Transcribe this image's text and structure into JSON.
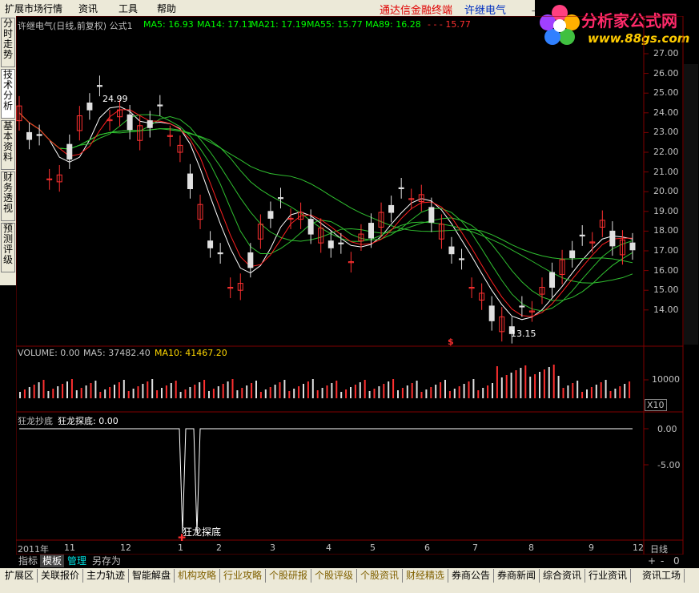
{
  "menubar": {
    "items": [
      "扩展市场行情",
      "资讯",
      "工具",
      "帮助"
    ],
    "brand_title": "通达信金融终端",
    "brand_stock": "许继电气",
    "window_buttons": [
      "_",
      "□",
      "×"
    ]
  },
  "logo": {
    "text": "分析家公式网",
    "url": "www.88gs.com"
  },
  "left_tabs": [
    "分时走势",
    "技术分析",
    "基本资料",
    "财务透视",
    "预测评级"
  ],
  "price_panel": {
    "title": "许继电气(日线,前复权) 公式1",
    "ma_labels": [
      "MA5: 16.93",
      "MA14: 17.11",
      "MA21: 17.19",
      "MA55: 15.77",
      "MA89: 16.28"
    ],
    "extra_marks": "- - -  15.77",
    "y_ticks": [
      "27.00",
      "26.00",
      "25.00",
      "24.00",
      "23.00",
      "22.00",
      "21.00",
      "20.00",
      "19.00",
      "18.00",
      "17.00",
      "16.00",
      "15.00",
      "14.00"
    ],
    "high_label": "24.99",
    "low_label": "13.15",
    "dollar_mark": "$"
  },
  "volume_panel": {
    "label": "VOLUME: 0.00",
    "ma5": "MA5: 37482.40",
    "ma10": "MA10: 41467.20",
    "y_tick": "10000",
    "unit": "X10"
  },
  "indicator_panel": {
    "title": "狂龙抄底",
    "value_label": "狂龙探底: 0.00",
    "y_ticks": [
      "0.00",
      "-5.00"
    ],
    "signal_label": "狂龙探底"
  },
  "time_axis": {
    "labels": [
      "2011年",
      "11",
      "12",
      "1",
      "2",
      "3",
      "4",
      "5",
      "6",
      "7",
      "8",
      "9",
      "12"
    ],
    "period": "日线"
  },
  "bottom_tabs": [
    "指标",
    "模板",
    "管理",
    "另存为"
  ],
  "bottom_nav": [
    "扩展区",
    "关联报价",
    "主力轨迹",
    "智能解盘",
    "机构攻略",
    "行业攻略",
    "个股研报",
    "个股评级",
    "个股资讯",
    "财经精选",
    "券商公告",
    "券商新闻",
    "综合资讯",
    "行业资讯",
    "资讯工场"
  ],
  "zoom_buttons": [
    "+",
    "-",
    "0"
  ],
  "colors": {
    "up": "#ff3030",
    "down": "#e0e0e0",
    "ma5": "#ffffff",
    "ma_green": "#30c030",
    "ma_red": "#ff2020",
    "grid": "#800000",
    "axis_text": "#c0c0c0",
    "title_green": "#00ff00",
    "ma10_yellow": "#ffd700"
  }
}
